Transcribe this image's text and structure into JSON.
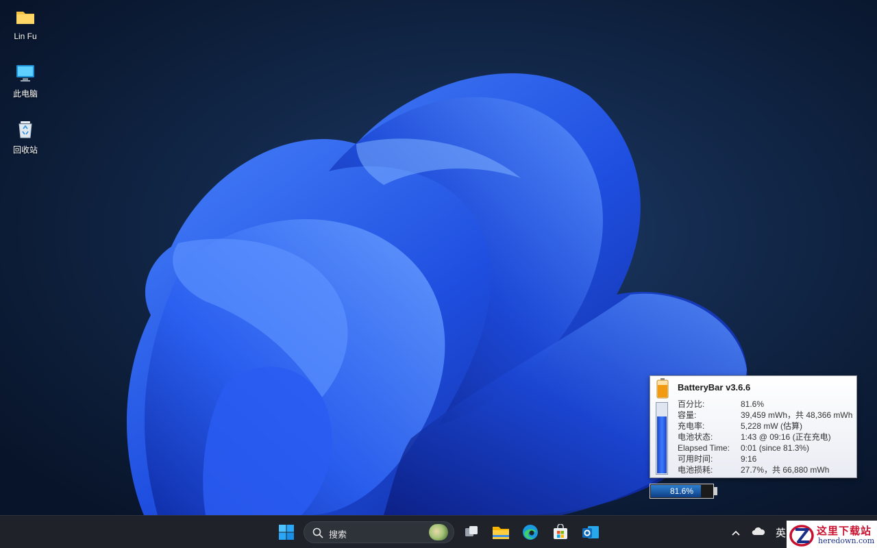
{
  "desktop": {
    "icons": [
      {
        "label": "Lin Fu",
        "icon": "folder-icon"
      },
      {
        "label": "此电脑",
        "icon": "computer-icon"
      },
      {
        "label": "回收站",
        "icon": "recycle-bin-icon"
      }
    ]
  },
  "batterybar_popup": {
    "title": "BatteryBar v3.6.6",
    "charge_fraction": 0.816,
    "rows": [
      {
        "key": "百分比:",
        "value": "81.6%"
      },
      {
        "key": "容量:",
        "value": "39,459 mWh，共 48,366 mWh"
      },
      {
        "key": "充电率:",
        "value": "5,228 mW (估算)"
      },
      {
        "key": "电池状态:",
        "value": "1:43 @ 09:16 (正在充电)"
      },
      {
        "key": "Elapsed Time:",
        "value": "0:01 (since 81.3%)"
      },
      {
        "key": "可用时间:",
        "value": "9:16"
      },
      {
        "key": "电池损耗:",
        "value": "27.7%，共 66,880 mWh"
      }
    ]
  },
  "battery_bar": {
    "text": "81.6%",
    "level": 0.816
  },
  "taskbar": {
    "search_label": "搜索",
    "apps": [
      "start-icon",
      "task-view-icon",
      "file-explorer-icon",
      "edge-icon",
      "store-icon",
      "outlook-icon"
    ],
    "tray": {
      "ime": "英"
    }
  },
  "watermark": {
    "text": "这里下载站",
    "url": "heredown.com"
  },
  "colors": {
    "taskbar": "#1f2329",
    "accent": "#3e7bff",
    "watermark_red": "#c8102e"
  }
}
